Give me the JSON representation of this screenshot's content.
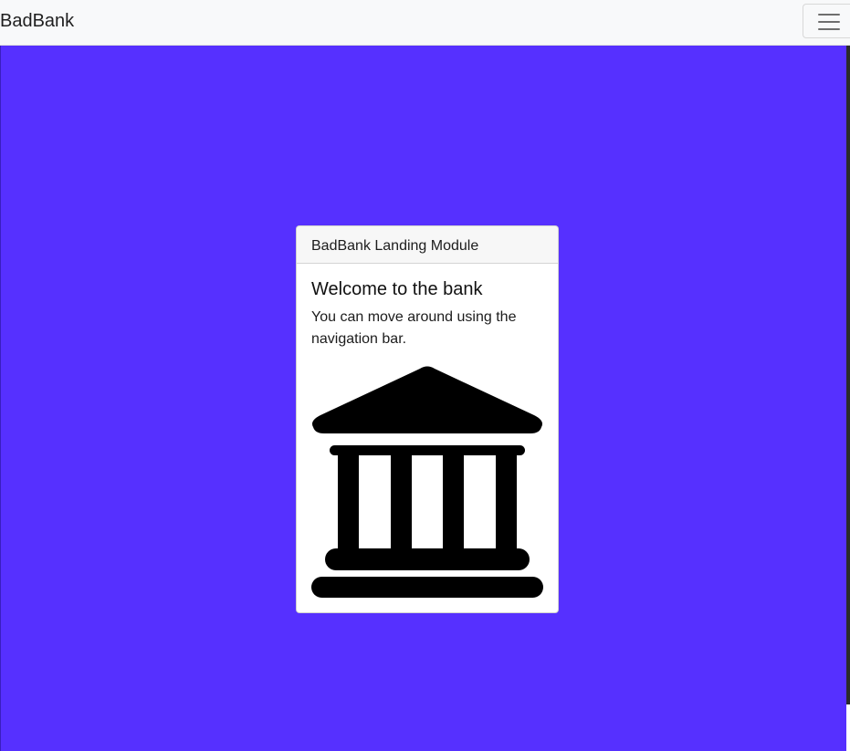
{
  "navbar": {
    "brand": "BadBank",
    "toggler_icon": "hamburger-menu-icon"
  },
  "colors": {
    "page_background": "#5630ff",
    "navbar_background": "#f8f9fa",
    "card_background": "#ffffff"
  },
  "card": {
    "header": "BadBank Landing Module",
    "title": "Welcome to the bank",
    "text": "You can move around using the navigation bar.",
    "image_icon": "bank-building-icon"
  }
}
